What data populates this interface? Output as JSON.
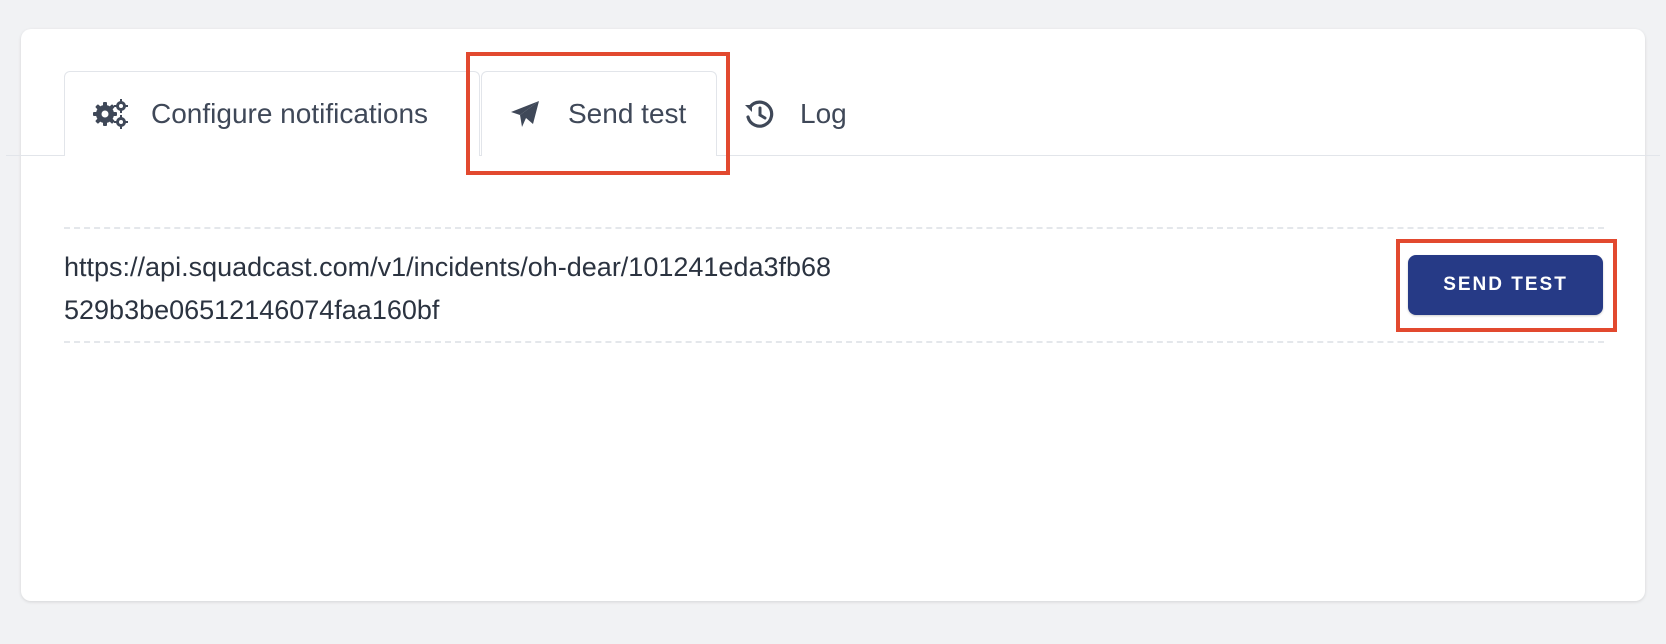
{
  "tabs": [
    {
      "label": "Configure notifications",
      "icon": "gears-icon"
    },
    {
      "label": "Send test",
      "icon": "paper-plane-icon"
    },
    {
      "label": "Log",
      "icon": "history-icon"
    }
  ],
  "endpoint": {
    "url": "https://api.squadcast.com/v1/incidents/oh-dear/101241eda3fb68529b3be06512146074faa160bf"
  },
  "send_button": {
    "label": "SEND TEST"
  },
  "colors": {
    "button_bg": "#263a86",
    "highlight": "#e2492f",
    "page_bg": "#f1f2f4"
  }
}
